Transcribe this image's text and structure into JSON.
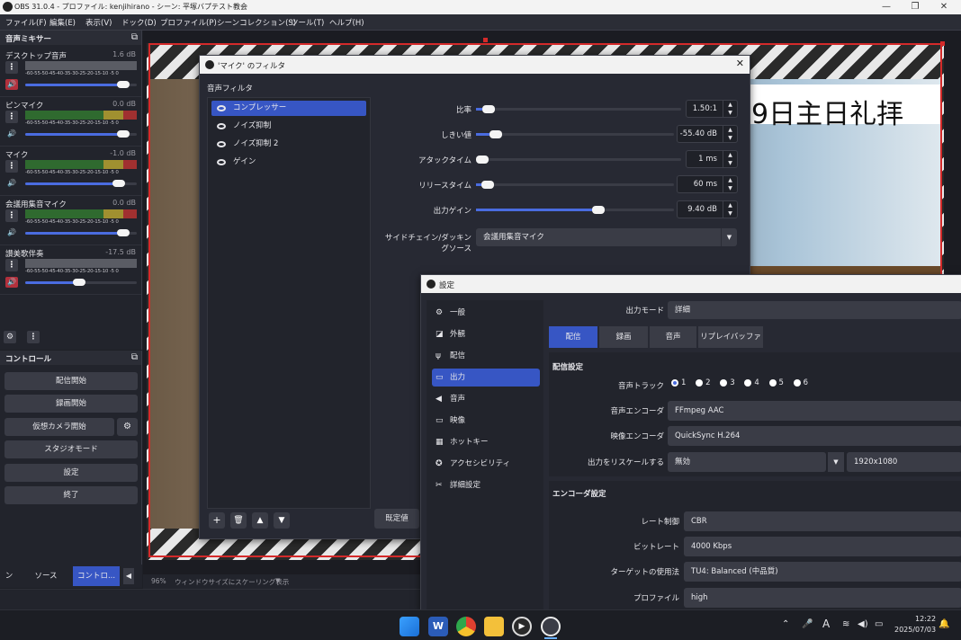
{
  "titlebar": {
    "title": "OBS 31.0.4 - プロファイル: kenjihirano - シーン: 平塚バプテスト教会",
    "min": "—",
    "max": "❐",
    "close": "✕"
  },
  "menu": [
    "ファイル(F)",
    "編集(E)",
    "表示(V)",
    "ドック(D)",
    "プロファイル(P)",
    "シーンコレクション(S)",
    "ツール(T)",
    "ヘルプ(H)"
  ],
  "mixer": {
    "title": "音声ミキサー",
    "scale": "-60-55-50-45-40-35-30-25-20-15-10 -5  0",
    "channels": [
      {
        "name": "デスクトップ音声",
        "db": "1.6 dB",
        "muted": true,
        "level": 0.88
      },
      {
        "name": "ピンマイク",
        "db": "0.0 dB",
        "muted": false,
        "level": 0.88
      },
      {
        "name": "マイク",
        "db": "-1.0 dB",
        "muted": false,
        "level": 0.84
      },
      {
        "name": "会議用集音マイク",
        "db": "0.0 dB",
        "muted": false,
        "level": 0.88
      },
      {
        "name": "讃美歌伴奏",
        "db": "-17.5 dB",
        "muted": true,
        "level": 0.48
      }
    ]
  },
  "controls": {
    "title": "コントロール",
    "buttons": [
      "配信開始",
      "録画開始",
      "仮想カメラ開始",
      "スタジオモード",
      "設定",
      "終了"
    ]
  },
  "bottomtabs": [
    "ン",
    "ソース",
    "コントロ..."
  ],
  "preview": {
    "overlay_text": "9日主日礼拝",
    "zoom": "96%",
    "scale_mode": "ウィンドウサイズにスケーリング表示"
  },
  "filters": {
    "title": "'マイク' のフィルタ",
    "section": "音声フィルタ",
    "items": [
      "コンプレッサー",
      "ノイズ抑制",
      "ノイズ抑制 2",
      "ゲイン"
    ],
    "params": [
      {
        "label": "比率",
        "value": "1.50:1",
        "pos": 0.03
      },
      {
        "label": "しきい値",
        "value": "-55.40 dB",
        "pos": 0.1
      },
      {
        "label": "アタックタイム",
        "value": "1 ms",
        "pos": 0.0
      },
      {
        "label": "リリースタイム",
        "value": "60 ms",
        "pos": 0.06
      },
      {
        "label": "出力ゲイン",
        "value": "9.40 dB",
        "pos": 0.62
      }
    ],
    "sidechain_label": "サイドチェイン/ダッキングソース",
    "sidechain_value": "会議用集音マイク",
    "defaults": "既定値"
  },
  "settings": {
    "title": "設定",
    "nav": [
      {
        "label": "一般",
        "icon": "⚙"
      },
      {
        "label": "外観",
        "icon": "◪"
      },
      {
        "label": "配信",
        "icon": "ψ"
      },
      {
        "label": "出力",
        "icon": "▭"
      },
      {
        "label": "音声",
        "icon": "◀"
      },
      {
        "label": "映像",
        "icon": "▭"
      },
      {
        "label": "ホットキー",
        "icon": "▦"
      },
      {
        "label": "アクセシビリティ",
        "icon": "✪"
      },
      {
        "label": "詳細設定",
        "icon": "✂"
      }
    ],
    "output_mode_label": "出力モード",
    "output_mode": "詳細",
    "tabs": [
      "配信",
      "録画",
      "音声",
      "リプレイバッファ"
    ],
    "stream_section": "配信設定",
    "audio_track_label": "音声トラック",
    "tracks": [
      "1",
      "2",
      "3",
      "4",
      "5",
      "6"
    ],
    "audio_encoder_label": "音声エンコーダ",
    "audio_encoder": "FFmpeg AAC",
    "video_encoder_label": "映像エンコーダ",
    "video_encoder": "QuickSync H.264",
    "rescale_label": "出力をリスケールする",
    "rescale": "無効",
    "rescale_res": "1920x1080",
    "encoder_section": "エンコーダ設定",
    "rate_label": "レート制御",
    "rate": "CBR",
    "bitrate_label": "ビットレート",
    "bitrate": "4000 Kbps",
    "target_label": "ターゲットの使用法",
    "target": "TU4: Balanced (中品質)",
    "profile_label": "プロファイル",
    "profile": "high"
  },
  "taskbar": {
    "time": "12:22",
    "date": "2025/07/03",
    "ime": "A"
  }
}
